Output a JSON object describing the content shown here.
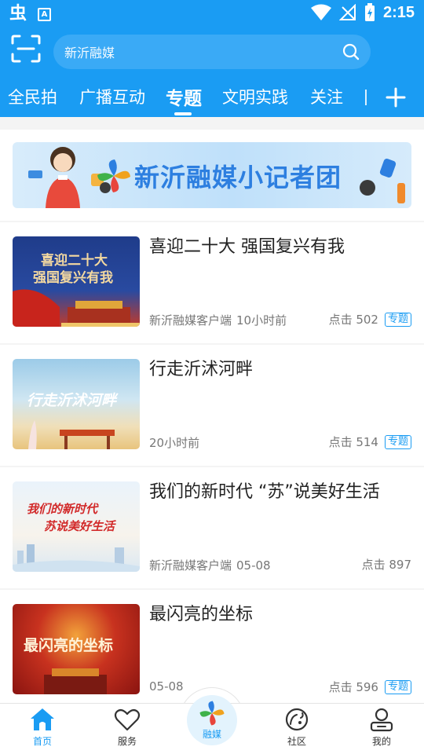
{
  "status_bar": {
    "app_glyph": "虫",
    "a_glyph": "A",
    "time": "2:15"
  },
  "search": {
    "placeholder": "新沂融媒"
  },
  "tabs": [
    {
      "label": "全民拍",
      "active": false
    },
    {
      "label": "广播互动",
      "active": false
    },
    {
      "label": "专题",
      "active": true
    },
    {
      "label": "文明实践",
      "active": false
    },
    {
      "label": "关注",
      "active": false
    }
  ],
  "banner": {
    "title": "新沂融媒小记者团"
  },
  "news": [
    {
      "title": "喜迎二十大 强国复兴有我",
      "source": "新沂融媒客户端",
      "time": "10小时前",
      "clicks": "点击 502",
      "tag": "专题",
      "thumb_text_1": "喜迎二十大",
      "thumb_text_2": "强国复兴有我"
    },
    {
      "title": "行走沂沭河畔",
      "source": "",
      "time": "20小时前",
      "clicks": "点击 514",
      "tag": "专题",
      "thumb_text_1": "行走沂沭河畔"
    },
    {
      "title": "我们的新时代 “苏”说美好生活",
      "source": "新沂融媒客户端",
      "time": "05-08",
      "clicks": "点击 897",
      "tag": "",
      "thumb_text_1": "我们的新时代",
      "thumb_text_2": "苏说美好生活"
    },
    {
      "title": "最闪亮的坐标",
      "source": "",
      "time": "05-08",
      "clicks": "点击 596",
      "tag": "专题",
      "thumb_text_1": "最闪亮的坐标"
    }
  ],
  "bottom_nav": {
    "home": "首页",
    "service": "服务",
    "center": "融媒",
    "community": "社区",
    "mine": "我的"
  },
  "colors": {
    "brand_blue": "#1a9cf3",
    "text_gray": "#777777"
  }
}
